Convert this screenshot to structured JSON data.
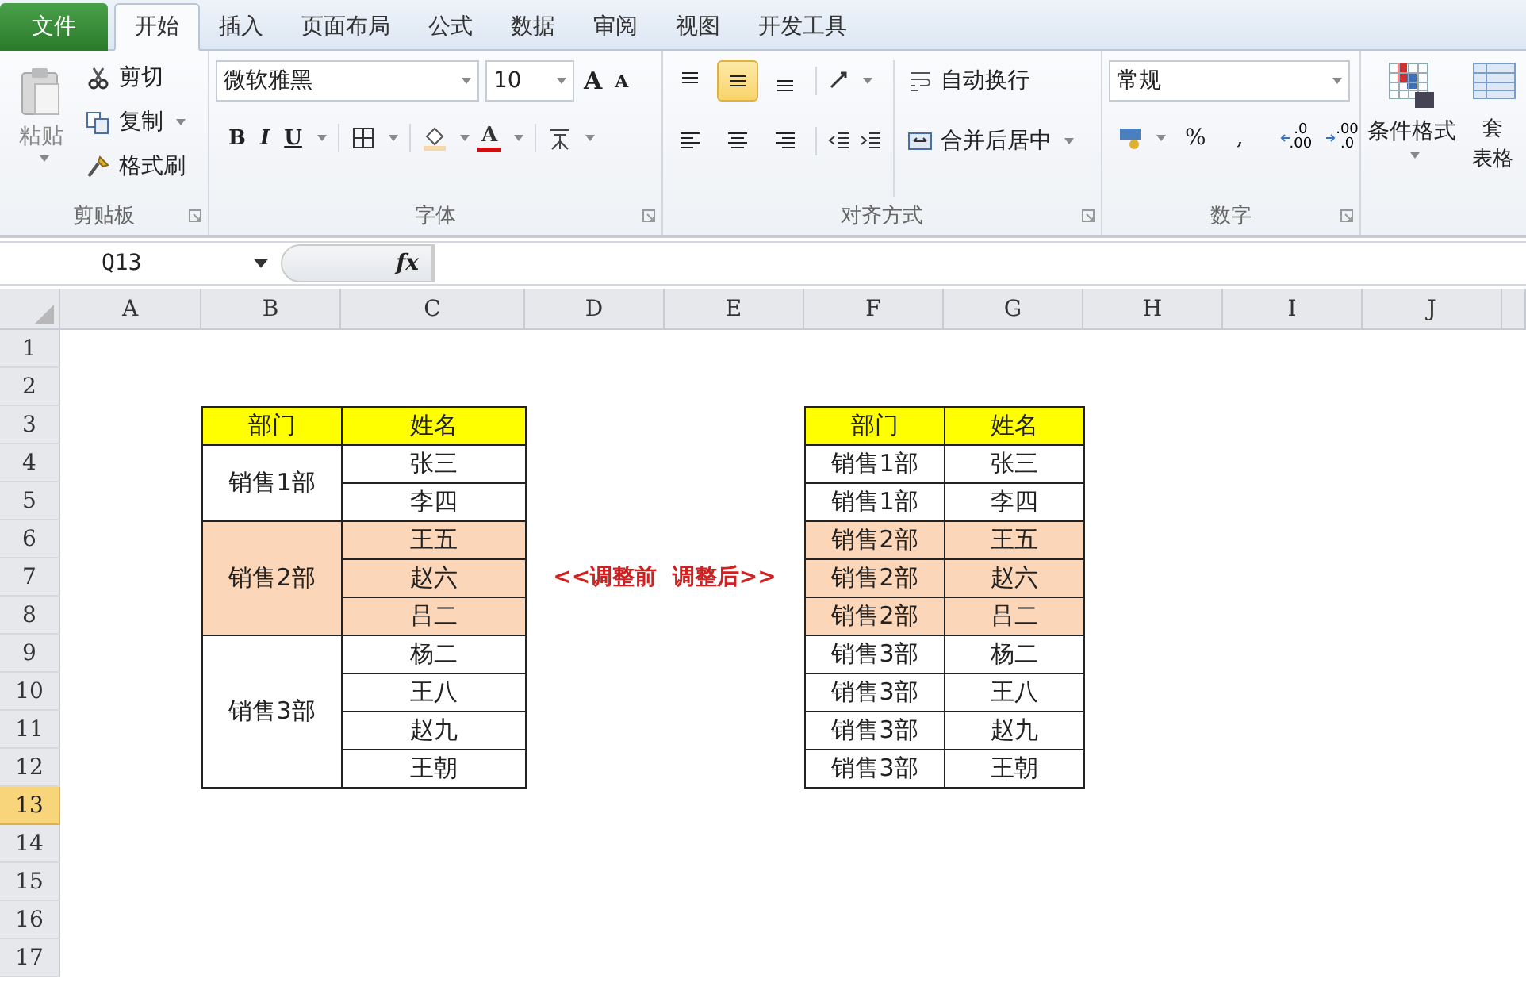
{
  "tabs": [
    {
      "label": "文件",
      "kind": "file",
      "selected": false
    },
    {
      "label": "开始",
      "kind": "tab",
      "selected": true
    },
    {
      "label": "插入",
      "kind": "tab",
      "selected": false
    },
    {
      "label": "页面布局",
      "kind": "tab",
      "selected": false
    },
    {
      "label": "公式",
      "kind": "tab",
      "selected": false
    },
    {
      "label": "数据",
      "kind": "tab",
      "selected": false
    },
    {
      "label": "审阅",
      "kind": "tab",
      "selected": false
    },
    {
      "label": "视图",
      "kind": "tab",
      "selected": false
    },
    {
      "label": "开发工具",
      "kind": "tab",
      "selected": false
    }
  ],
  "clipboard": {
    "paste": "粘贴",
    "group_label": "剪贴板",
    "actions": [
      {
        "label": "剪切",
        "kind": "cut",
        "dropdown": false
      },
      {
        "label": "复制",
        "kind": "copy",
        "dropdown": true
      },
      {
        "label": "格式刷",
        "kind": "brush",
        "dropdown": false
      }
    ]
  },
  "font": {
    "family": "微软雅黑",
    "size": "10",
    "grow": "A",
    "shrink": "A",
    "font_color": "A",
    "group_label": "字体",
    "styles": [
      {
        "label": "B",
        "kind": "bold"
      },
      {
        "label": "I",
        "kind": "italic"
      },
      {
        "label": "U",
        "kind": "underline"
      }
    ]
  },
  "alignment": {
    "wrap": "自动换行",
    "merge": "合并后居中",
    "group_label": "对齐方式",
    "vertical": [
      {
        "kind": "top",
        "selected": false
      },
      {
        "kind": "middle",
        "selected": true
      },
      {
        "kind": "bottom",
        "selected": false
      }
    ],
    "horizontal": [
      {
        "kind": "left",
        "selected": false
      },
      {
        "kind": "center",
        "selected": false
      },
      {
        "kind": "right",
        "selected": false
      }
    ]
  },
  "number": {
    "format": "常规",
    "percent": "%",
    "comma": ",",
    "group_label": "数字",
    "decimals": [
      {
        "kind": "increase",
        "top": ".0",
        "bottom": ".00"
      },
      {
        "kind": "decrease",
        "top": ".00",
        "bottom": ".0"
      }
    ]
  },
  "styles": {
    "conditional": "条件格式",
    "table_format": [
      "套",
      "表格"
    ]
  },
  "formula_bar": {
    "name_box": "Q13",
    "fx": "fx"
  },
  "sheet": {
    "columns": [
      {
        "label": "A",
        "selected": false
      },
      {
        "label": "B",
        "selected": false
      },
      {
        "label": "C",
        "selected": false
      },
      {
        "label": "D",
        "selected": false
      },
      {
        "label": "E",
        "selected": false
      },
      {
        "label": "F",
        "selected": false
      },
      {
        "label": "G",
        "selected": false
      },
      {
        "label": "H",
        "selected": false
      },
      {
        "label": "I",
        "selected": false
      },
      {
        "label": "J",
        "selected": false
      }
    ],
    "rows": [
      {
        "label": "1",
        "selected": false
      },
      {
        "label": "2",
        "selected": false
      },
      {
        "label": "3",
        "selected": false
      },
      {
        "label": "4",
        "selected": false
      },
      {
        "label": "5",
        "selected": false
      },
      {
        "label": "6",
        "selected": false
      },
      {
        "label": "7",
        "selected": false
      },
      {
        "label": "8",
        "selected": false
      },
      {
        "label": "9",
        "selected": false
      },
      {
        "label": "10",
        "selected": false
      },
      {
        "label": "11",
        "selected": false
      },
      {
        "label": "12",
        "selected": false
      },
      {
        "label": "13",
        "selected": true
      },
      {
        "label": "14",
        "selected": false
      },
      {
        "label": "15",
        "selected": false
      },
      {
        "label": "16",
        "selected": false
      },
      {
        "label": "17",
        "selected": false
      }
    ],
    "left_table": {
      "header": [
        "部门",
        "姓名"
      ],
      "groups": [
        {
          "dept": "销售1部",
          "highlighted": false,
          "names": [
            "张三",
            "李四"
          ]
        },
        {
          "dept": "销售2部",
          "highlighted": true,
          "names": [
            "王五",
            "赵六",
            "吕二"
          ]
        },
        {
          "dept": "销售3部",
          "highlighted": false,
          "names": [
            "杨二",
            "王八",
            "赵九",
            "王朝"
          ]
        }
      ]
    },
    "note": "<<调整前  调整后>>",
    "right_table": {
      "header": [
        "部门",
        "姓名"
      ],
      "rows": [
        {
          "dept": "销售1部",
          "name": "张三",
          "highlighted": false
        },
        {
          "dept": "销售1部",
          "name": "李四",
          "highlighted": false
        },
        {
          "dept": "销售2部",
          "name": "王五",
          "highlighted": true
        },
        {
          "dept": "销售2部",
          "name": "赵六",
          "highlighted": true
        },
        {
          "dept": "销售2部",
          "name": "吕二",
          "highlighted": true
        },
        {
          "dept": "销售3部",
          "name": "杨二",
          "highlighted": false
        },
        {
          "dept": "销售3部",
          "name": "王八",
          "highlighted": false
        },
        {
          "dept": "销售3部",
          "name": "赵九",
          "highlighted": false
        },
        {
          "dept": "销售3部",
          "name": "王朝",
          "highlighted": false
        }
      ]
    }
  }
}
